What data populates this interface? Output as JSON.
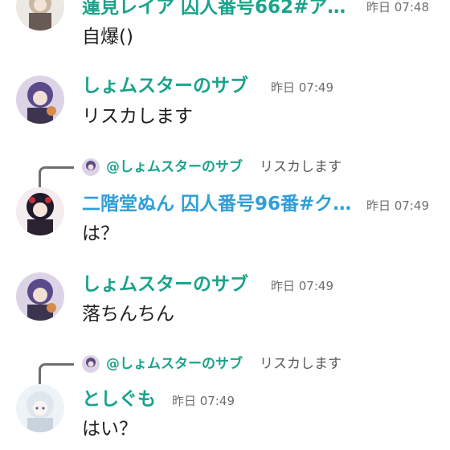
{
  "colors": {
    "name_green": "#1aa38a",
    "name_blue": "#2f9fd8",
    "time_grey": "#6f6f6f",
    "reply_line": "#6f6f6f"
  },
  "messages": [
    {
      "author": "蓮見レイア 囚人番号662#ア…",
      "time": "昨日 07:48",
      "text": "自爆()"
    },
    {
      "author": "しょムスターのサブ",
      "time": "昨日 07:49",
      "text": "リスカします"
    },
    {
      "reply_to": {
        "author": "@しょムスターのサブ",
        "text": "リスカします"
      },
      "author": "二階堂ぬん 囚人番号96番#ク…",
      "time": "昨日 07:49",
      "text": "は？"
    },
    {
      "author": "しょムスターのサブ",
      "time": "昨日 07:49",
      "text": "落ちんちん"
    },
    {
      "reply_to": {
        "author": "@しょムスターのサブ",
        "text": "リスカします"
      },
      "author": "としぐも",
      "time": "昨日 07:49",
      "text": "はい？"
    }
  ]
}
